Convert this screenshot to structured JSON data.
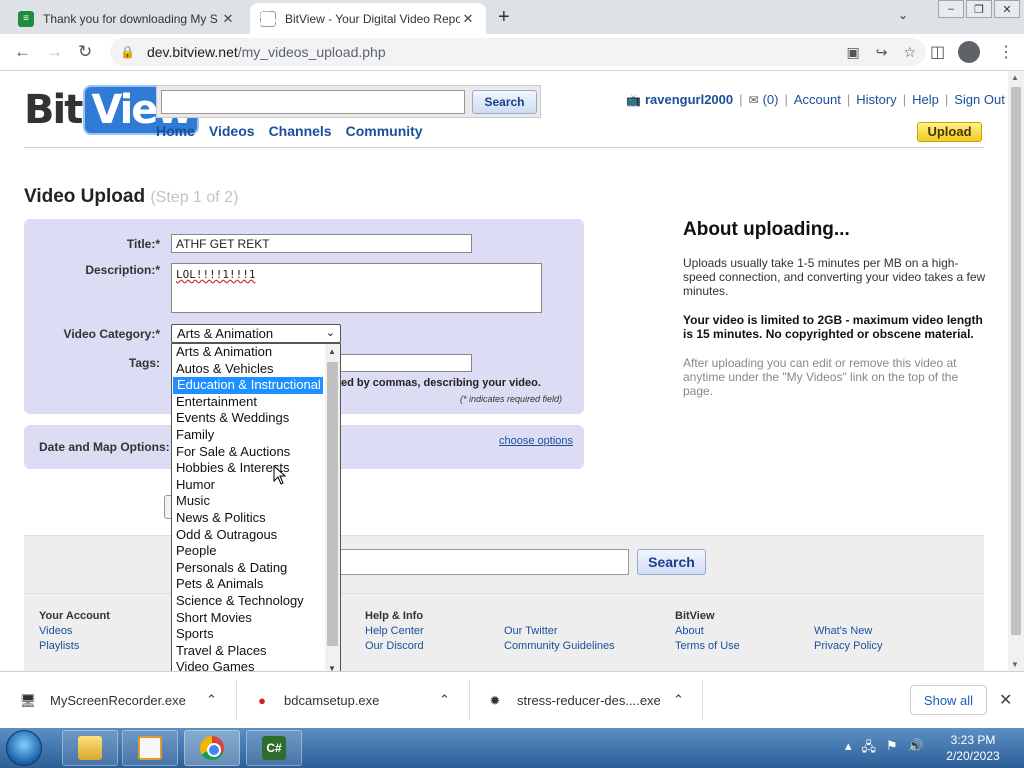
{
  "browser": {
    "tabs": [
      {
        "title": "Thank you for downloading My S",
        "active": false
      },
      {
        "title": "BitView - Your Digital Video Repo",
        "active": true
      }
    ],
    "url_host": "dev.bitview.net",
    "url_path": "/my_videos_upload.php"
  },
  "site": {
    "logo_bit": "Bit",
    "logo_view": "View",
    "search_button": "Search",
    "nav": [
      "Home",
      "Videos",
      "Channels",
      "Community"
    ],
    "user": {
      "username": "ravengurl2000",
      "mail_count": "(0)",
      "links": [
        "Account",
        "History",
        "Help",
        "Sign Out"
      ]
    },
    "upload_button": "Upload"
  },
  "form": {
    "title": "Video Upload",
    "step": "(Step 1 of 2)",
    "title_label": "Title:*",
    "title_value": "ATHF GET REKT",
    "description_label": "Description:*",
    "description_value": "LOL!!!!1!!!1",
    "category_label": "Video Category:*",
    "category_value": "Arts & Animation",
    "tags_label": "Tags:",
    "tags_hint": "ed by commas, describing your video.",
    "required_note": "(* indicates required field)",
    "date_map_label": "Date and Map Options:",
    "choose_options": "choose options"
  },
  "category_options": [
    "Arts & Animation",
    "Autos & Vehicles",
    "Education & Instructional",
    "Entertainment",
    "Events & Weddings",
    "Family",
    "For Sale & Auctions",
    "Hobbies & Interests",
    "Humor",
    "Music",
    "News & Politics",
    "Odd & Outragous",
    "People",
    "Personals & Dating",
    "Pets & Animals",
    "Science & Technology",
    "Short Movies",
    "Sports",
    "Travel & Places",
    "Video Games"
  ],
  "category_highlighted": "Education & Instructional",
  "about": {
    "heading": "About uploading...",
    "p1": "Uploads usually take 1-5 minutes per MB on a high-speed connection, and converting your video takes a few minutes.",
    "p2": "Your video is limited to 2GB - maximum video length is 15 minutes. No copyrighted or obscene material.",
    "p3": "After uploading you can edit or remove this video at anytime under the \"My Videos\" link on the top of the page."
  },
  "footer": {
    "search_button": "Search",
    "your_account": "Your Account",
    "your_account_links": [
      "Videos",
      "Playlists"
    ],
    "help_info": "Help & Info",
    "help_links": [
      "Help Center",
      "Our Discord"
    ],
    "help_links2": [
      "Our Twitter",
      "Community Guidelines"
    ],
    "bitview": "BitView",
    "bitview_links": [
      "About",
      "Terms of Use"
    ],
    "bitview_links2": [
      "What's New",
      "Privacy Policy"
    ]
  },
  "downloads": {
    "items": [
      "MyScreenRecorder.exe",
      "bdcamsetup.exe",
      "stress-reducer-des....exe"
    ],
    "show_all": "Show all"
  },
  "taskbar": {
    "time": "3:23 PM",
    "date": "2/20/2023",
    "cs_label": "C#"
  },
  "colors": {
    "accent_blue": "#1b4e9b",
    "panel_lavender": "#dcdcf5",
    "upload_yellow": "#f2cc22",
    "selection_blue": "#1e90ff"
  }
}
